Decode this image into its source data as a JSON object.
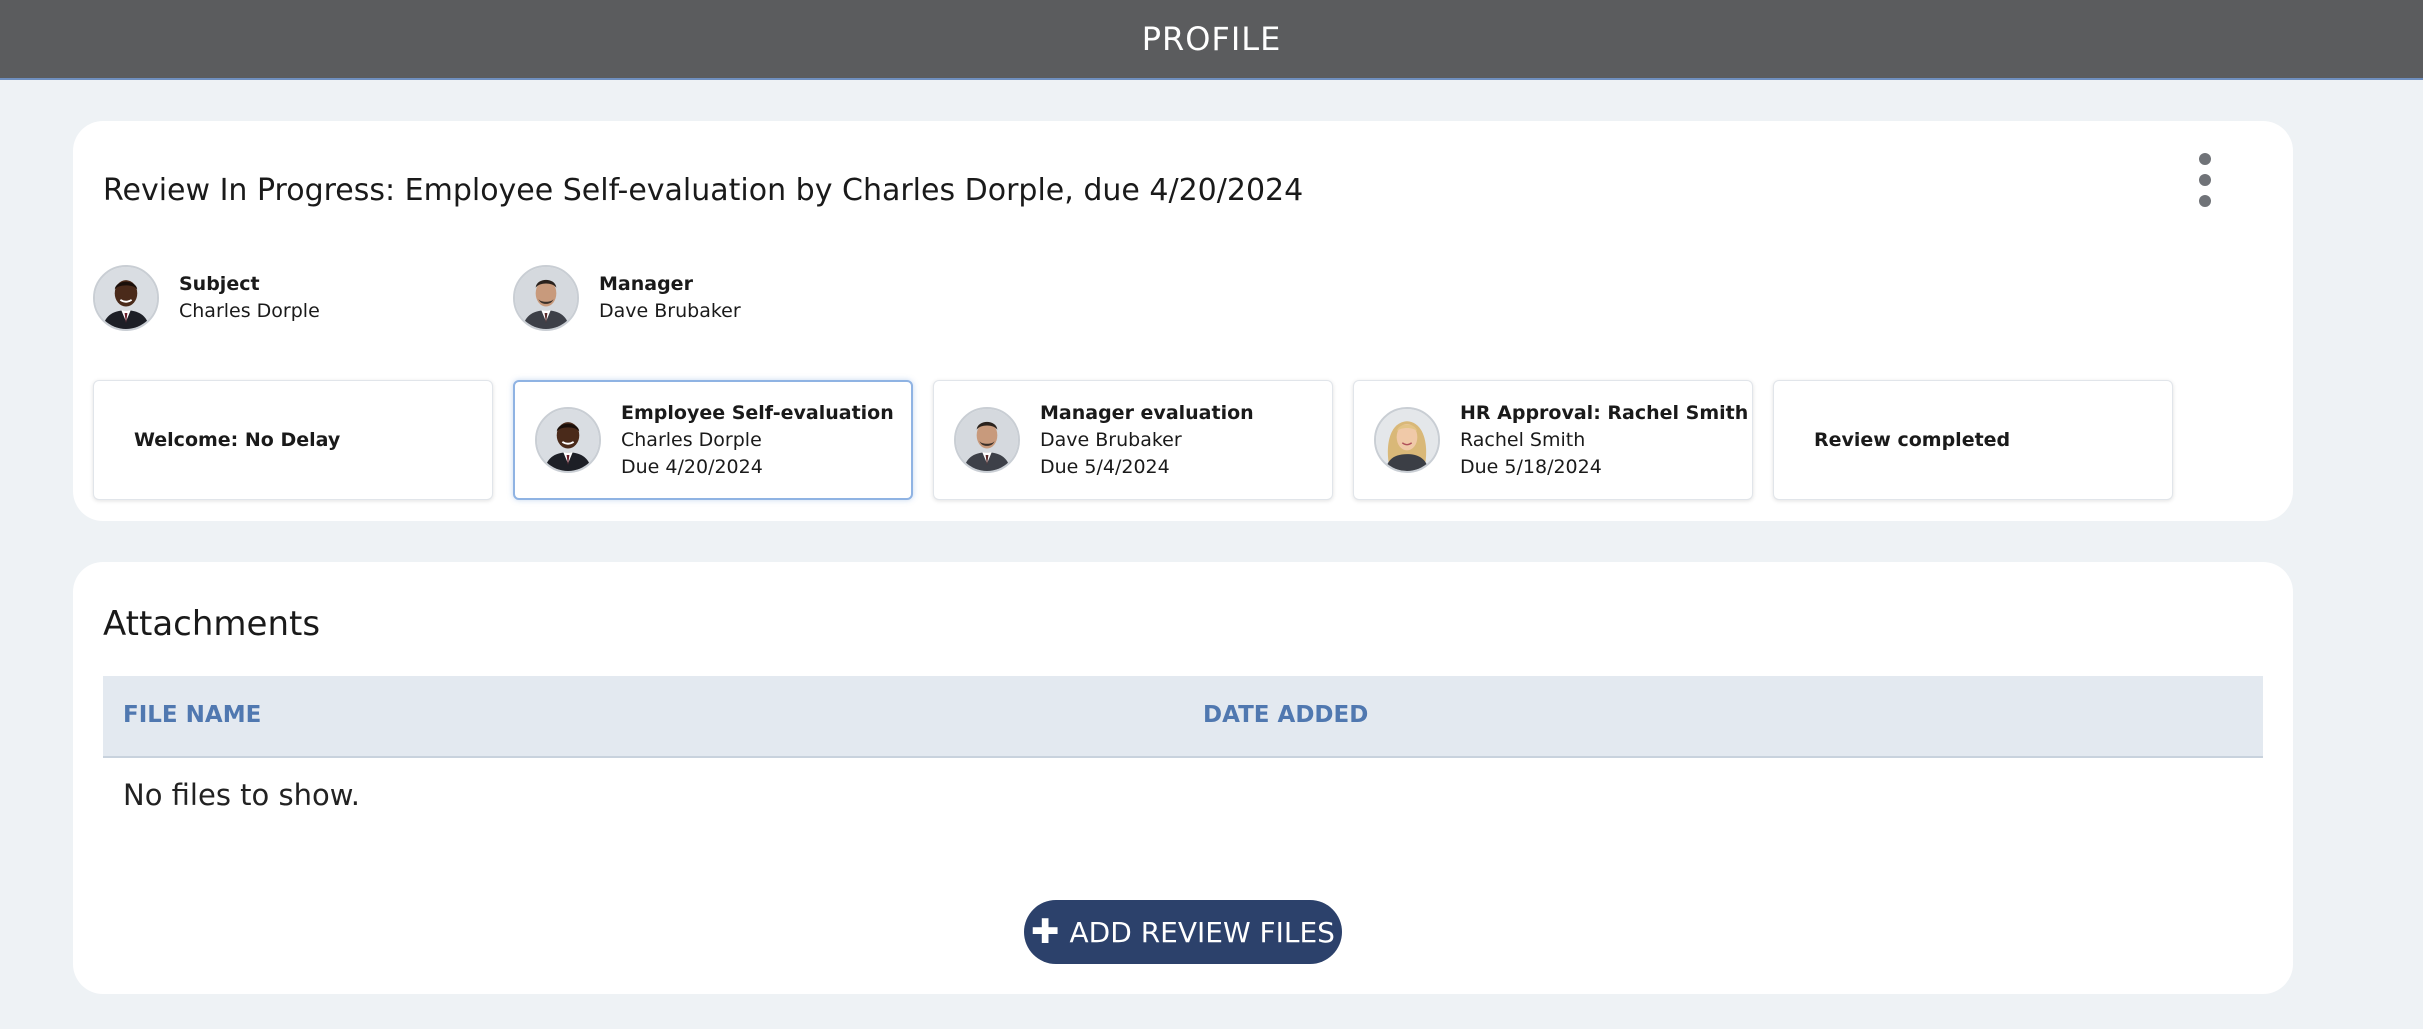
{
  "header": {
    "title": "PROFILE"
  },
  "review": {
    "title": "Review In Progress: Employee Self-evaluation by Charles Dorple, due 4/20/2024",
    "menu_icon": "more-vertical-icon",
    "subject": {
      "role": "Subject",
      "name": "Charles Dorple"
    },
    "manager": {
      "role": "Manager",
      "name": "Dave Brubaker"
    },
    "steps": [
      {
        "name": "Welcome: No Delay"
      },
      {
        "name": "Employee Self-evaluation",
        "person": "Charles Dorple",
        "due": "Due 4/20/2024"
      },
      {
        "name": "Manager evaluation",
        "person": "Dave Brubaker",
        "due": "Due 5/4/2024"
      },
      {
        "name": "HR Approval: Rachel Smith",
        "person": "Rachel Smith",
        "due": "Due 5/18/2024"
      },
      {
        "name": "Review completed"
      }
    ]
  },
  "attachments": {
    "title": "Attachments",
    "columns": [
      "FILE NAME",
      "DATE ADDED"
    ],
    "empty_text": "No files to show.",
    "add_button": "ADD REVIEW FILES",
    "add_icon": "plus-icon"
  },
  "colors": {
    "topbar": "#5b5c5e",
    "accent_navy": "#2c416b",
    "header_text_blue": "#5078b0",
    "active_step_border": "#8fb3e3"
  }
}
